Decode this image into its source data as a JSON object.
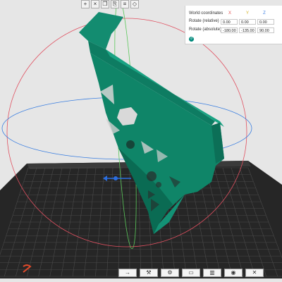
{
  "panel": {
    "title": "World coordinates",
    "axes": [
      "X",
      "Y",
      "Z"
    ],
    "rows": [
      {
        "label": "Rotate (relative)",
        "values": [
          "0.00",
          "0.00",
          "0.00"
        ]
      },
      {
        "label": "Rotate (absolute)",
        "values": [
          "-180.00",
          "-135.00",
          "90.00"
        ]
      }
    ],
    "axis_colors": [
      "#e05050",
      "#e0c020",
      "#3a7ee0"
    ]
  },
  "top_toolbar": {
    "icons": [
      "add-object-icon",
      "delete-icon",
      "copy-icon",
      "paste-icon",
      "layers-icon",
      "measure-icon"
    ]
  },
  "bottom_toolbar": {
    "icons": [
      "arrow-right-icon",
      "tools-icon",
      "wrench-icon",
      "placeholder-icon",
      "ruler-icon",
      "eye-icon",
      "close-icon"
    ]
  },
  "colors": {
    "model": "#0e8a6e",
    "bed": "#2a2a2a",
    "grid": "#444444",
    "accent": "#00897b"
  }
}
